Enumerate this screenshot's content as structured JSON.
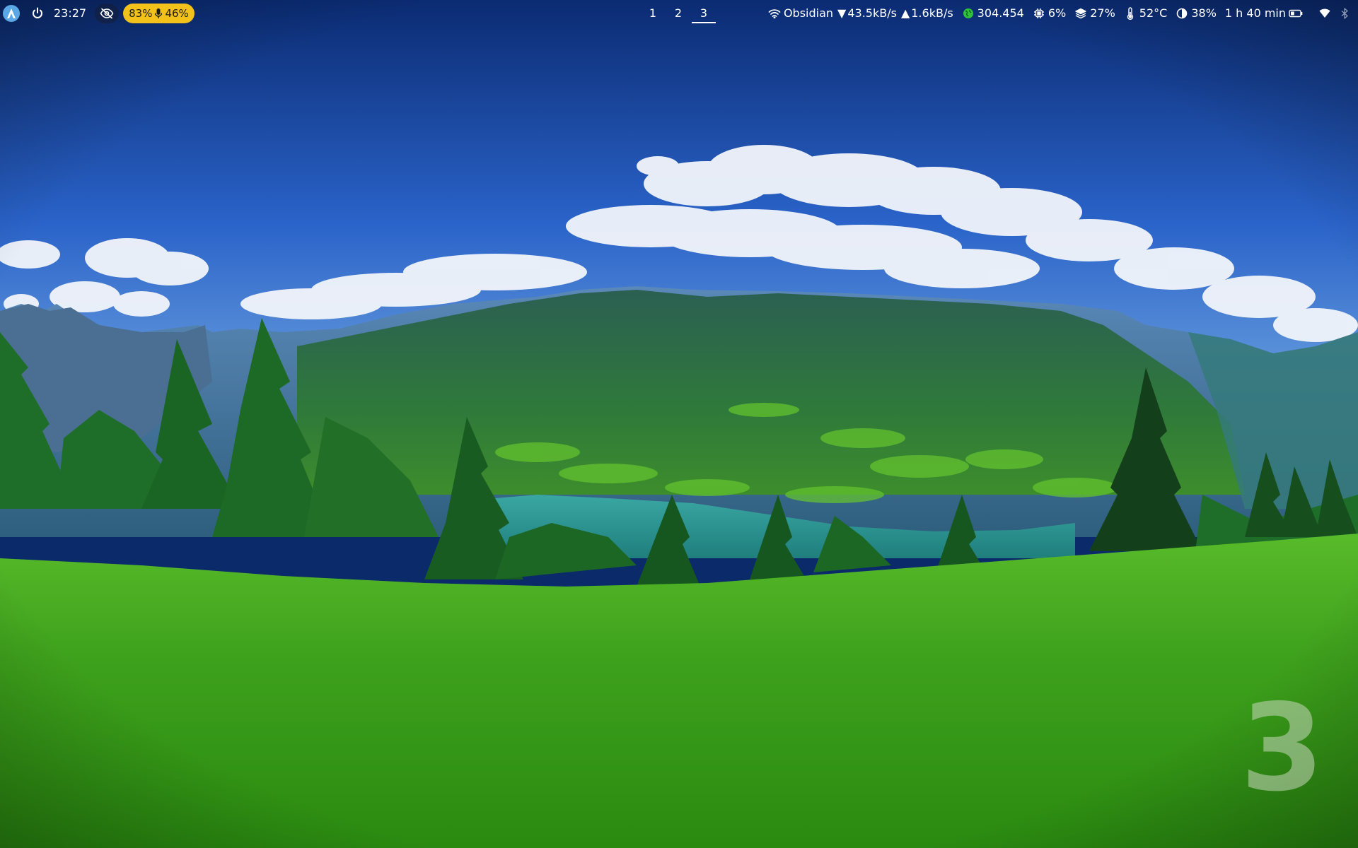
{
  "wallpaper": {
    "description_icon": "landscape-wallpaper-icon",
    "colors": {
      "sky_top": "#0b2b72",
      "sky_mid": "#2a63c9",
      "sky_horizon": "#8cc0ea",
      "cloud": "#f2f5fb",
      "mountain_far": "#3f6f9c",
      "mountain_mid": "#2e6a4a",
      "lake": "#2e9a95",
      "tree": "#1e6e2a",
      "meadow_far": "#4cb226",
      "meadow_near": "#2f8f14"
    }
  },
  "topbar": {
    "launcher_icon": "arch-launcher-icon",
    "power_icon": "power-icon",
    "clock": "23:27",
    "privacy_icon": "eye-off-icon",
    "audio": {
      "volume": "83%",
      "mic_icon": "microphone-icon",
      "mic": "46%",
      "color": "#f2c21b"
    },
    "workspaces": [
      {
        "label": "1",
        "active": false
      },
      {
        "label": "2",
        "active": false
      },
      {
        "label": "3",
        "active": true
      }
    ],
    "network": {
      "icon": "wifi-icon",
      "ssid": "Obsidian",
      "down": "43.5kB/s",
      "up": "1.6kB/s"
    },
    "crypto": {
      "icon": "globe-icon",
      "value": "304.454",
      "color": "#2fc23a"
    },
    "cpu": {
      "icon": "cpu-icon",
      "value": "6%"
    },
    "memory": {
      "icon": "layers-icon",
      "value": "27%"
    },
    "temperature": {
      "icon": "thermometer-icon",
      "value": "52°C"
    },
    "brightness": {
      "icon": "brightness-icon",
      "value": "38%"
    },
    "battery": {
      "icon": "battery-icon",
      "value": "1 h 40 min",
      "level": 0.4
    },
    "tray": [
      {
        "icon": "wifi-tray-icon"
      },
      {
        "icon": "bluetooth-icon"
      }
    ]
  },
  "watermark": {
    "workspace_number": "3"
  }
}
